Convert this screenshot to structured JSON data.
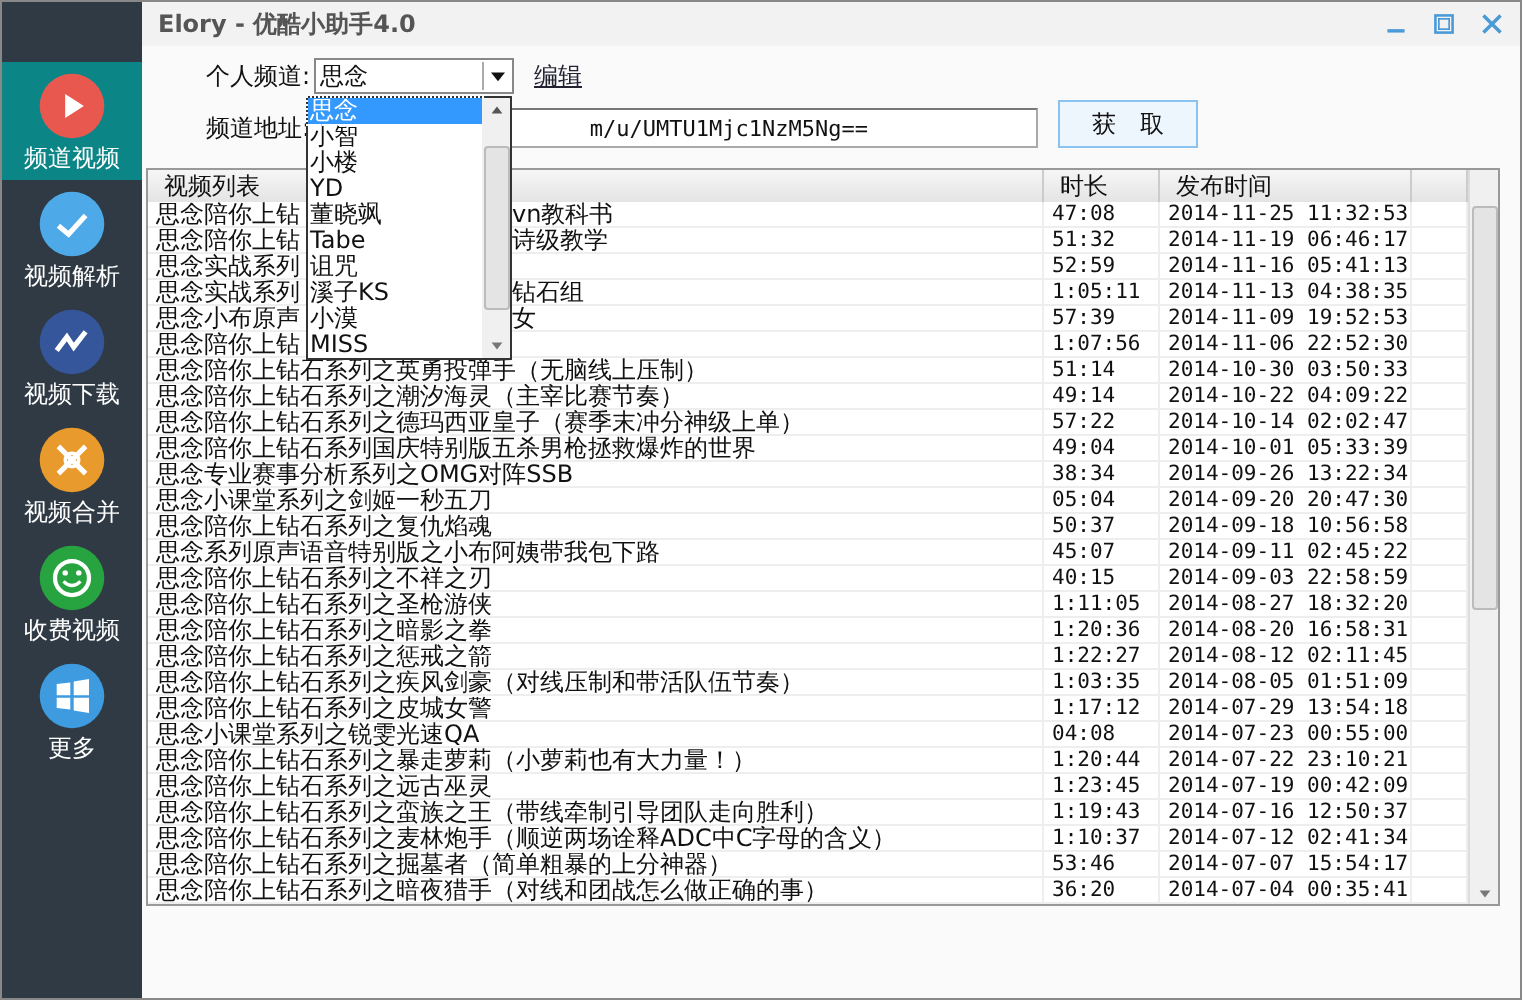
{
  "window": {
    "title": "Elory - 优酷小助手4.0"
  },
  "sidebar": {
    "items": [
      {
        "label": "频道视频",
        "selected": true,
        "color": "#e8584f",
        "kind": "play"
      },
      {
        "label": "视频解析",
        "selected": false,
        "color": "#4ea9e8",
        "kind": "check"
      },
      {
        "label": "视频下载",
        "selected": false,
        "color": "#35569a",
        "kind": "wave"
      },
      {
        "label": "视频合并",
        "selected": false,
        "color": "#e99a2c",
        "kind": "merge"
      },
      {
        "label": "收费视频",
        "selected": false,
        "color": "#27a33f",
        "kind": "smile"
      },
      {
        "label": "更多",
        "selected": false,
        "color": "#3f9be0",
        "kind": "windows"
      }
    ]
  },
  "channel": {
    "label": "个人频道:",
    "value": "思念",
    "edit_link": "编辑"
  },
  "address": {
    "label": "频道地址:",
    "value": "m/u/UMTU1Mjc1NzM5Ng=="
  },
  "fetch_button": "获　取",
  "table": {
    "columns": [
      "视频列表",
      "时长",
      "发布时间"
    ],
    "rows": [
      {
        "title": "思念陪你上钻",
        "title_end": "vn教科书",
        "duration": "47:08",
        "published": "2014-11-25 11:32:53"
      },
      {
        "title": "思念陪你上钻",
        "title_end": "诗级教学",
        "duration": "51:32",
        "published": "2014-11-19 06:46:17"
      },
      {
        "title": "思念实战系列",
        "duration": "52:59",
        "published": "2014-11-16 05:41:13"
      },
      {
        "title": "思念实战系列",
        "title_end": "钻石组",
        "duration": "1:05:11",
        "published": "2014-11-13 04:38:35"
      },
      {
        "title": "思念小布原声",
        "title_end": "女",
        "duration": "57:39",
        "published": "2014-11-09 19:52:53"
      },
      {
        "title": "思念陪你上钻",
        "duration": "1:07:56",
        "published": "2014-11-06 22:52:30"
      },
      {
        "title": "思念陪你上钻石系列之英勇投弹手（无脑线上压制）",
        "duration": "51:14",
        "published": "2014-10-30 03:50:33"
      },
      {
        "title": "思念陪你上钻石系列之潮汐海灵（主宰比赛节奏）",
        "duration": "49:14",
        "published": "2014-10-22 04:09:22"
      },
      {
        "title": "思念陪你上钻石系列之德玛西亚皇子（赛季末冲分神级上单）",
        "duration": "57:22",
        "published": "2014-10-14 02:02:47"
      },
      {
        "title": "思念陪你上钻石系列国庆特别版五杀男枪拯救爆炸的世界",
        "duration": "49:04",
        "published": "2014-10-01 05:33:39"
      },
      {
        "title": "思念专业赛事分析系列之OMG对阵SSB",
        "duration": "38:34",
        "published": "2014-09-26 13:22:34"
      },
      {
        "title": "思念小课堂系列之剑姬一秒五刀",
        "duration": "05:04",
        "published": "2014-09-20 20:47:30"
      },
      {
        "title": "思念陪你上钻石系列之复仇焰魂",
        "duration": "50:37",
        "published": "2014-09-18 10:56:58"
      },
      {
        "title": "思念系列原声语音特别版之小布阿姨带我包下路",
        "duration": "45:07",
        "published": "2014-09-11 02:45:22"
      },
      {
        "title": "思念陪你上钻石系列之不祥之刃",
        "duration": "40:15",
        "published": "2014-09-03 22:58:59"
      },
      {
        "title": "思念陪你上钻石系列之圣枪游侠",
        "duration": "1:11:05",
        "published": "2014-08-27 18:32:20"
      },
      {
        "title": "思念陪你上钻石系列之暗影之拳",
        "duration": "1:20:36",
        "published": "2014-08-20 16:58:31"
      },
      {
        "title": "思念陪你上钻石系列之惩戒之箭",
        "duration": "1:22:27",
        "published": "2014-08-12 02:11:45"
      },
      {
        "title": "思念陪你上钻石系列之疾风剑豪（对线压制和带活队伍节奏）",
        "duration": "1:03:35",
        "published": "2014-08-05 01:51:09"
      },
      {
        "title": "思念陪你上钻石系列之皮城女警",
        "duration": "1:17:12",
        "published": "2014-07-29 13:54:18"
      },
      {
        "title": "思念小课堂系列之锐雯光速QA",
        "duration": "04:08",
        "published": "2014-07-23 00:55:00"
      },
      {
        "title": "思念陪你上钻石系列之暴走萝莉（小萝莉也有大力量！）",
        "duration": "1:20:44",
        "published": "2014-07-22 23:10:21"
      },
      {
        "title": "思念陪你上钻石系列之远古巫灵",
        "duration": "1:23:45",
        "published": "2014-07-19 00:42:09"
      },
      {
        "title": "思念陪你上钻石系列之蛮族之王（带线牵制引导团队走向胜利）",
        "duration": "1:19:43",
        "published": "2014-07-16 12:50:37"
      },
      {
        "title": "思念陪你上钻石系列之麦林炮手（顺逆两场诠释ADC中C字母的含义）",
        "duration": "1:10:37",
        "published": "2014-07-12 02:41:34"
      },
      {
        "title": "思念陪你上钻石系列之掘墓者（简单粗暴的上分神器）",
        "duration": "53:46",
        "published": "2014-07-07 15:54:17"
      },
      {
        "title": "思念陪你上钻石系列之暗夜猎手（对线和团战怎么做正确的事）",
        "duration": "36:20",
        "published": "2014-07-04 00:35:41"
      }
    ]
  },
  "dropdown": {
    "options": [
      {
        "label": "思念",
        "selected": true
      },
      {
        "label": "小智",
        "selected": false
      },
      {
        "label": "小楼",
        "selected": false
      },
      {
        "label": "YD",
        "selected": false
      },
      {
        "label": "董晓飒",
        "selected": false
      },
      {
        "label": "Tabe",
        "selected": false
      },
      {
        "label": "诅咒",
        "selected": false
      },
      {
        "label": "溪子KS",
        "selected": false
      },
      {
        "label": "小漠",
        "selected": false
      },
      {
        "label": "MISS",
        "selected": false
      }
    ]
  }
}
